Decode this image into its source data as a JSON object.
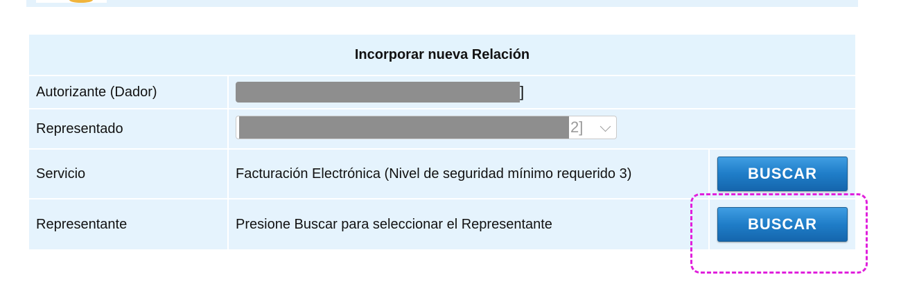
{
  "form": {
    "title": "Incorporar nueva Relación",
    "rows": [
      {
        "label": "Autorizante (Dador)",
        "value_prefix": "(",
        "value_suffix": "]"
      },
      {
        "label": "Representado",
        "select_suffix": "2]"
      },
      {
        "label": "Servicio",
        "value": "Facturación Electrónica (Nivel de seguridad mínimo requerido 3)",
        "button": "BUSCAR"
      },
      {
        "label": "Representante",
        "value": "Presione Buscar para seleccionar el Representante",
        "button": "BUSCAR"
      }
    ]
  },
  "colors": {
    "row_bg": "#e5f3fd",
    "button_blue": "#1f7dc8",
    "highlight": "#e020dc",
    "redaction": "#8e8e8e"
  }
}
